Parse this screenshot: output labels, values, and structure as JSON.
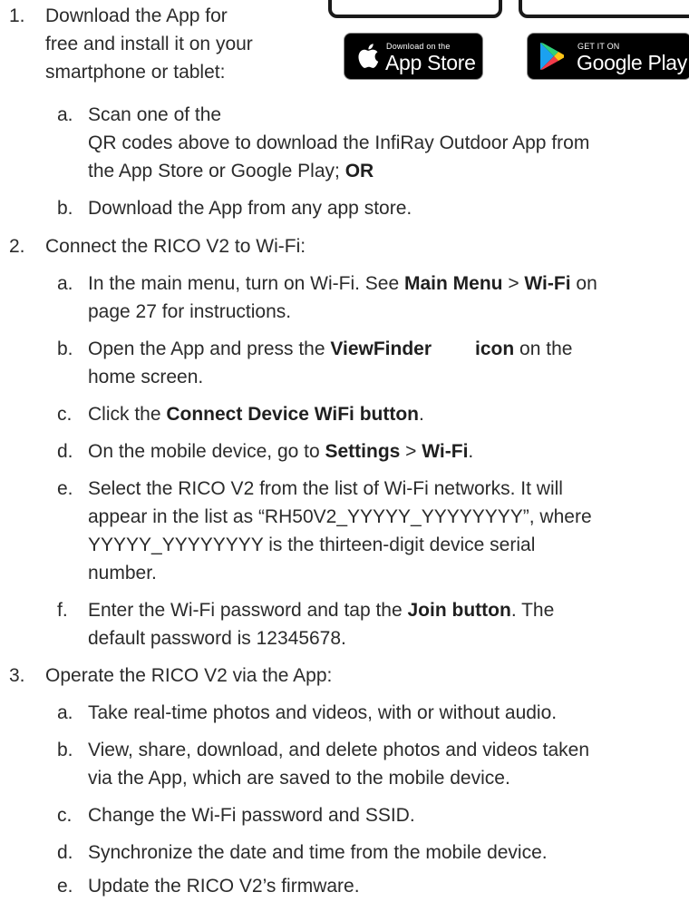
{
  "store_badges": {
    "app_store": {
      "small": "Download on the",
      "big": "App Store"
    },
    "google_play": {
      "small": "GET IT ON",
      "big": "Google Play"
    }
  },
  "steps": [
    {
      "num": "1.",
      "lines": [
        "Download the App for",
        "free and install it on your",
        "smartphone or tablet:"
      ],
      "subs": [
        {
          "letter": "a.",
          "line1": "Scan one of the",
          "line2": "QR codes above to download the InfiRay Outdoor App from",
          "line3_pre": "the App Store or Google Play; ",
          "line3_bold": "OR"
        },
        {
          "letter": "b.",
          "text": "Download the App from any app store."
        }
      ]
    },
    {
      "num": "2.",
      "text": "Connect the RICO V2 to Wi-Fi:",
      "subs": [
        {
          "letter": "a.",
          "pre": "In the main menu, turn on Wi-Fi. See ",
          "b1": "Main Menu",
          "mid": " > ",
          "b2": "Wi-Fi",
          "post": " on",
          "line2": "page 27 for instructions."
        },
        {
          "letter": "b.",
          "pre": "Open the App and press the ",
          "b1": "ViewFinder",
          "b2": "icon",
          "post": " on the",
          "line2": "home screen."
        },
        {
          "letter": "c.",
          "pre": "Click the ",
          "b1": "Connect Device WiFi button",
          "post": "."
        },
        {
          "letter": "d.",
          "pre": "On the mobile device, go to ",
          "b1": "Settings",
          "mid": " > ",
          "b2": "Wi-Fi",
          "post": "."
        },
        {
          "letter": "e.",
          "line1": "Select the RICO V2 from the list of Wi-Fi networks. It will",
          "line2": "appear in the list as “RH50V2_YYYYY_YYYYYYYY”, where",
          "line3": "YYYYY_YYYYYYYY is the thirteen-digit device serial",
          "line4": "number."
        },
        {
          "letter": "f.",
          "pre": "Enter the Wi-Fi password and tap the ",
          "b1": "Join button",
          "post": ". The",
          "line2": "default password is 12345678."
        }
      ]
    },
    {
      "num": "3.",
      "text": "Operate the RICO V2 via the App:",
      "subs": [
        {
          "letter": "a.",
          "text": "Take real-time photos and videos, with or without audio."
        },
        {
          "letter": "b.",
          "line1": "View, share, download, and delete photos and videos taken",
          "line2": "via the App, which are saved to the mobile device."
        },
        {
          "letter": "c.",
          "text": "Change the Wi-Fi password and SSID."
        },
        {
          "letter": "d.",
          "text": "Synchronize the date and time from the mobile device."
        },
        {
          "letter": "e.",
          "text": "Update the RICO V2’s firmware."
        }
      ]
    }
  ]
}
